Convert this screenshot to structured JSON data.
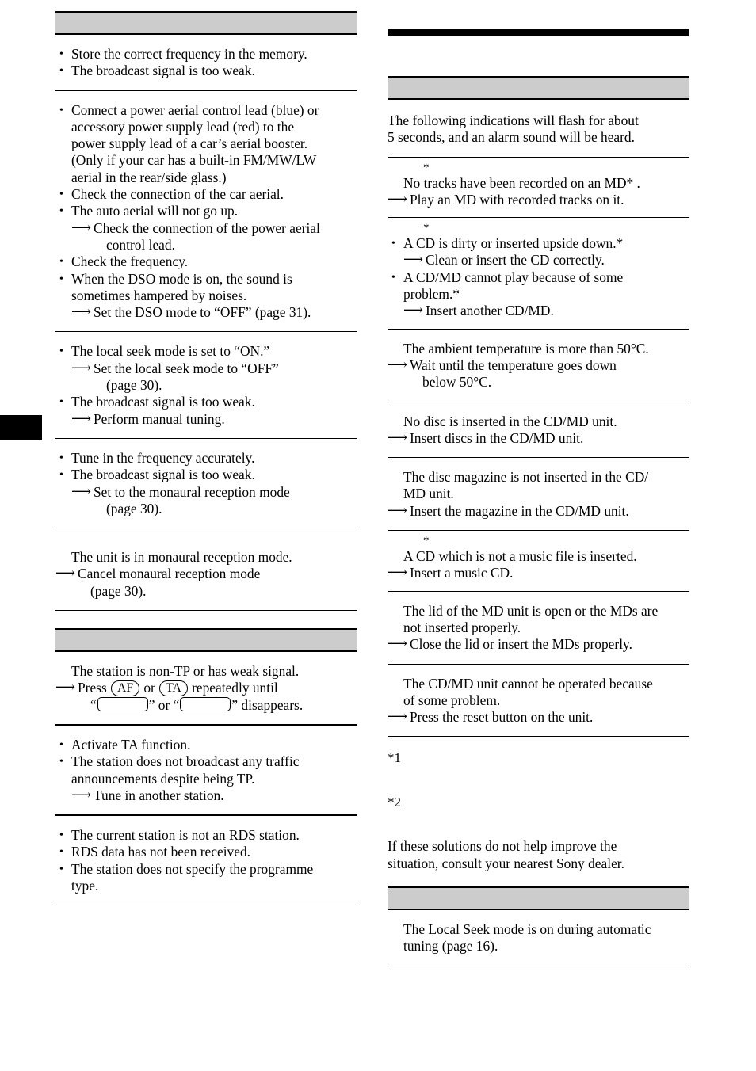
{
  "page": {
    "thumb_tab": "",
    "left_column": {
      "header_bar_label": "",
      "sections": [
        {
          "id": "preset-tuning",
          "lines": [
            {
              "type": "bullet",
              "text": "Store the correct frequency in the memory."
            },
            {
              "type": "bullet",
              "text": "The broadcast signal is too weak."
            }
          ]
        },
        {
          "id": "reception",
          "lines": [
            {
              "type": "bullet",
              "text": "Connect a power aerial control lead (blue) or"
            },
            {
              "type": "cont0",
              "text": "accessory power supply lead (red) to the"
            },
            {
              "type": "cont0",
              "text": "power supply lead of a car’s aerial booster."
            },
            {
              "type": "cont0",
              "text": "(Only if your car has a built-in FM/MW/LW"
            },
            {
              "type": "cont0",
              "text": "aerial in the rear/side glass.)"
            },
            {
              "type": "bullet",
              "text": "Check the connection of the car aerial."
            },
            {
              "type": "bullet",
              "text": "The auto aerial will not go up."
            },
            {
              "type": "arrow",
              "text": "Check the connection of the power aerial"
            },
            {
              "type": "cont",
              "text": "control lead."
            },
            {
              "type": "bullet",
              "text": "Check the frequency."
            },
            {
              "type": "bullet",
              "text": "When the DSO mode is on, the sound is"
            },
            {
              "type": "cont0",
              "text": "sometimes hampered by noises."
            },
            {
              "type": "arrow",
              "text": "Set the DSO mode to “OFF” (page 31)."
            }
          ]
        },
        {
          "id": "auto-tuning",
          "lines": [
            {
              "type": "bullet",
              "text": "The local seek mode is set to “ON.”"
            },
            {
              "type": "arrow",
              "text": "Set the local seek mode to “OFF”"
            },
            {
              "type": "cont",
              "text": "(page 30)."
            },
            {
              "type": "bullet",
              "text": "The broadcast signal is too weak."
            },
            {
              "type": "arrow",
              "text": "Perform manual tuning."
            }
          ]
        },
        {
          "id": "noisy-reception",
          "lines": [
            {
              "type": "bullet",
              "text": "Tune in the frequency accurately."
            },
            {
              "type": "bullet",
              "text": "The broadcast signal is too weak."
            },
            {
              "type": "arrow",
              "text": "Set to the monaural reception mode"
            },
            {
              "type": "cont",
              "text": "(page 30)."
            }
          ]
        },
        {
          "id": "stereo",
          "lines": [
            {
              "type": "plain",
              "text": "The unit is in monaural reception mode."
            },
            {
              "type": "arrow0",
              "text": "Cancel monaural reception mode"
            },
            {
              "type": "cont0indent",
              "text": "(page 30)."
            }
          ]
        }
      ],
      "rds_header_bar_label": "",
      "rds_sections": [
        {
          "id": "seek-starts",
          "lines": [
            {
              "type": "plain",
              "text": "The station is non-TP or has weak signal."
            },
            {
              "type": "arrow-keys",
              "prefix": "Press ",
              "key1": "AF",
              "mid": " or ",
              "key2": "TA",
              "suffix": " repeatedly until"
            },
            {
              "type": "cont-blanks",
              "open_quote": "“",
              "mid": "” or “",
              "suffix": "” disappears."
            }
          ]
        },
        {
          "id": "no-traffic",
          "lines": [
            {
              "type": "bullet",
              "text": "Activate TA function."
            },
            {
              "type": "bullet",
              "text": "The station does not broadcast any traffic"
            },
            {
              "type": "cont0",
              "text": "announcements despite being TP."
            },
            {
              "type": "arrow",
              "text": "Tune in another station."
            }
          ]
        },
        {
          "id": "pty-display",
          "lines": [
            {
              "type": "bullet",
              "text": "The current station is not an RDS station."
            },
            {
              "type": "bullet",
              "text": "RDS data has not been received."
            },
            {
              "type": "bullet",
              "text": "The station does not specify the programme"
            },
            {
              "type": "cont0",
              "text": "type."
            }
          ]
        }
      ]
    },
    "right_column": {
      "top_black_bar": "",
      "header_bar_label": "",
      "intro": [
        "The following indications will flash for about",
        "5 seconds, and an alarm sound will be heard."
      ],
      "sections": [
        {
          "id": "blank-md",
          "marker": "*",
          "lines": [
            {
              "type": "plain",
              "text": "No tracks have been recorded on an MD* ."
            },
            {
              "type": "arrow0",
              "text": "Play an MD with recorded tracks on it."
            }
          ]
        },
        {
          "id": "error",
          "marker": "*",
          "lines": [
            {
              "type": "bullet",
              "text": "A CD is dirty or inserted upside down.*"
            },
            {
              "type": "arrow",
              "text": "Clean or insert the CD correctly."
            },
            {
              "type": "bullet",
              "text": "A CD/MD cannot play because of some"
            },
            {
              "type": "cont0",
              "text": "problem.*"
            },
            {
              "type": "arrow",
              "text": "Insert another CD/MD."
            }
          ]
        },
        {
          "id": "high-temp",
          "marker": "",
          "lines": [
            {
              "type": "plain",
              "text": "The ambient temperature is more than 50°C."
            },
            {
              "type": "arrow0",
              "text": "Wait until the temperature goes down"
            },
            {
              "type": "cont0indent",
              "text": "below 50°C."
            }
          ]
        },
        {
          "id": "no-disc",
          "marker": "",
          "lines": [
            {
              "type": "plain",
              "text": "No disc is inserted in the CD/MD unit."
            },
            {
              "type": "arrow0",
              "text": "Insert discs in the CD/MD unit."
            }
          ]
        },
        {
          "id": "no-magazine",
          "marker": "",
          "lines": [
            {
              "type": "plain",
              "text": "The disc magazine is not inserted in the CD/"
            },
            {
              "type": "plain",
              "text": "MD unit."
            },
            {
              "type": "arrow0",
              "text": "Insert the magazine in the CD/MD unit."
            }
          ]
        },
        {
          "id": "not-ready",
          "marker": "*",
          "lines": [
            {
              "type": "plain",
              "text": "A CD which is not a music file is inserted."
            },
            {
              "type": "arrow0",
              "text": "Insert a music CD."
            }
          ]
        },
        {
          "id": "md-lid-open",
          "marker": "",
          "lines": [
            {
              "type": "plain",
              "text": "The lid of the MD unit is open or the MDs are"
            },
            {
              "type": "plain",
              "text": "not inserted properly."
            },
            {
              "type": "arrow0",
              "text": "Close the lid or insert the MDs properly."
            }
          ]
        },
        {
          "id": "reset",
          "marker": "",
          "lines": [
            {
              "type": "plain",
              "text": "The CD/MD unit cannot be operated because"
            },
            {
              "type": "plain",
              "text": "of some problem."
            },
            {
              "type": "arrow0",
              "text": "Press the reset button on the unit."
            }
          ]
        }
      ],
      "footnotes": [
        {
          "label": "*1",
          "text": ""
        },
        {
          "label": "*2",
          "text": ""
        }
      ],
      "closing": [
        "If these solutions do not help improve the",
        "situation, consult your nearest Sony dealer."
      ],
      "messages_header_bar_label": "",
      "messages_sections": [
        {
          "id": "local-seek",
          "lines": [
            {
              "type": "plain",
              "text": "The Local Seek mode is on during automatic"
            },
            {
              "type": "plain",
              "text": "tuning (page 16)."
            }
          ]
        }
      ]
    }
  },
  "glyphs": {
    "bullet": "•",
    "arrow": "⟶",
    "asterisk": "*"
  }
}
